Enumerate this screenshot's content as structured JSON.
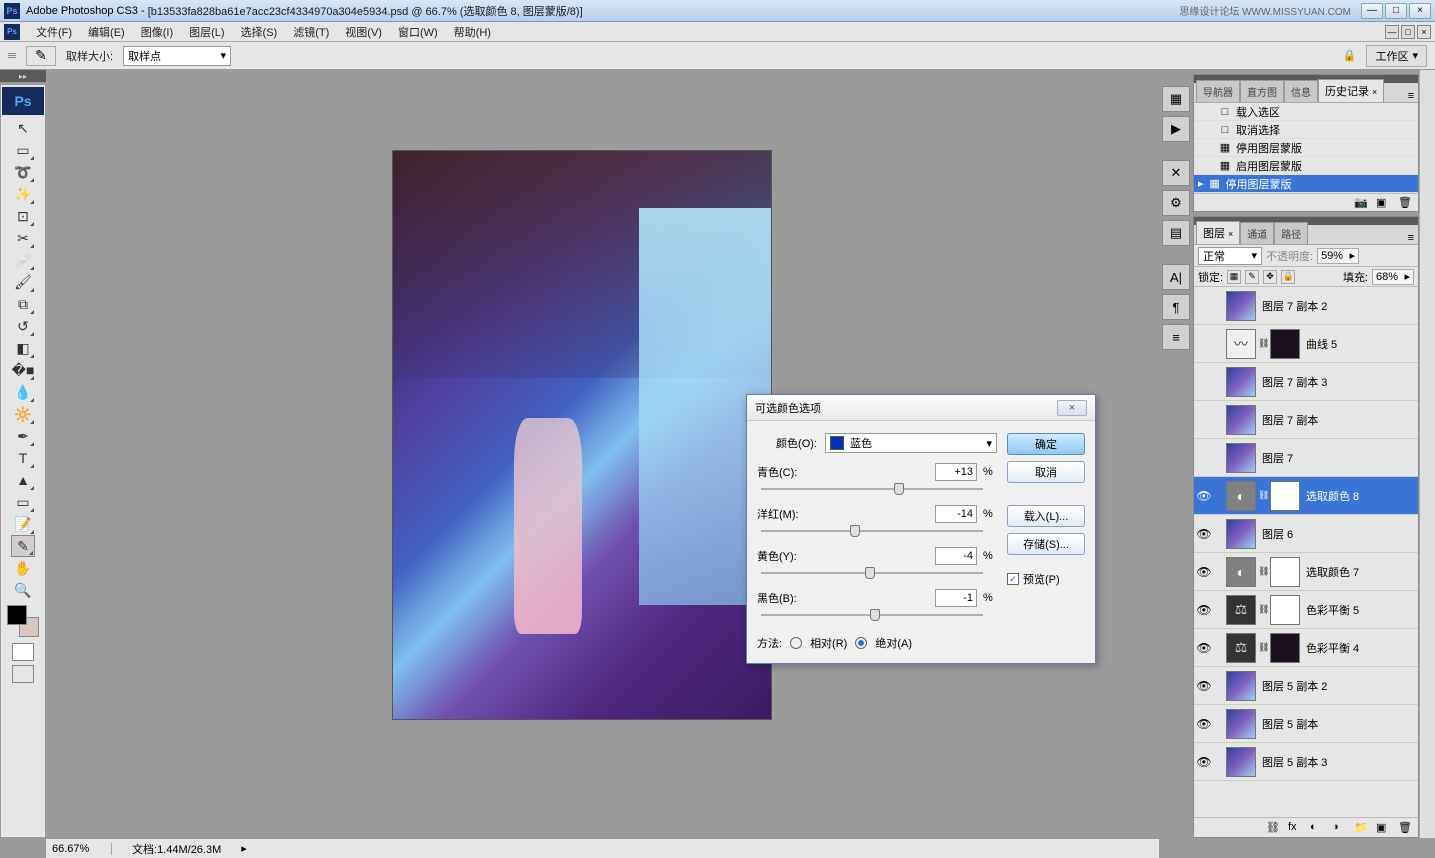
{
  "app": {
    "name": "Adobe Photoshop CS3",
    "doc_title": "[b13533fa828ba61e7acc23cf4334970a304e5934.psd @ 66.7% (选取颜色 8, 图层蒙版/8)]",
    "watermark": "思缘设计论坛 WWW.MISSYUAN.COM"
  },
  "menu": {
    "file": "文件(F)",
    "edit": "编辑(E)",
    "image": "图像(I)",
    "layer": "图层(L)",
    "select": "选择(S)",
    "filter": "滤镜(T)",
    "view": "视图(V)",
    "window": "窗口(W)",
    "help": "帮助(H)"
  },
  "options": {
    "sample_size_label": "取样大小:",
    "sample_size_value": "取样点",
    "workspace": "工作区"
  },
  "history_panel": {
    "tabs": {
      "nav": "导航器",
      "histogram": "直方图",
      "info": "信息",
      "history": "历史记录"
    },
    "items": [
      {
        "icon": "□",
        "label": "载入选区"
      },
      {
        "icon": "□",
        "label": "取消选择"
      },
      {
        "icon": "▦",
        "label": "停用图层蒙版"
      },
      {
        "icon": "▦",
        "label": "启用图层蒙版"
      },
      {
        "icon": "▦",
        "label": "停用图层蒙版"
      }
    ]
  },
  "layers_panel": {
    "tabs": {
      "layers": "图层",
      "channels": "通道",
      "paths": "路径"
    },
    "blend_mode": "正常",
    "opacity_label": "不透明度:",
    "opacity": "59%",
    "lock_label": "锁定:",
    "fill_label": "填充:",
    "fill": "68%",
    "layers": [
      {
        "visible": false,
        "thumb": "img",
        "name": "图层 7 副本 2"
      },
      {
        "visible": false,
        "thumb": "curves",
        "mask": "dark",
        "name": "曲线 5"
      },
      {
        "visible": false,
        "thumb": "img",
        "name": "图层 7 副本 3"
      },
      {
        "visible": false,
        "thumb": "img",
        "name": "图层 7 副本"
      },
      {
        "visible": false,
        "thumb": "img",
        "name": "图层 7"
      },
      {
        "visible": true,
        "thumb": "adjust",
        "mask": "white",
        "name": "选取颜色 8",
        "selected": true
      },
      {
        "visible": true,
        "thumb": "img",
        "name": "图层 6"
      },
      {
        "visible": true,
        "thumb": "adjust",
        "mask": "white",
        "name": "选取颜色 7"
      },
      {
        "visible": true,
        "thumb": "balance",
        "mask": "white",
        "name": "色彩平衡 5"
      },
      {
        "visible": true,
        "thumb": "balance",
        "mask": "dark",
        "name": "色彩平衡 4"
      },
      {
        "visible": true,
        "thumb": "img",
        "name": "图层 5 副本 2"
      },
      {
        "visible": true,
        "thumb": "img",
        "name": "图层 5 副本"
      },
      {
        "visible": true,
        "thumb": "img",
        "name": "图层 5 副本 3"
      }
    ]
  },
  "dialog": {
    "title": "可选颜色选项",
    "color_label": "颜色(O):",
    "color_value": "蓝色",
    "sliders": {
      "cyan": {
        "label": "青色(C):",
        "value": "+13",
        "pos": 60
      },
      "magenta": {
        "label": "洋红(M):",
        "value": "-14",
        "pos": 40
      },
      "yellow": {
        "label": "黄色(Y):",
        "value": "-4",
        "pos": 47
      },
      "black": {
        "label": "黑色(B):",
        "value": "-1",
        "pos": 49
      }
    },
    "method_label": "方法:",
    "relative": "相对(R)",
    "absolute": "绝对(A)",
    "buttons": {
      "ok": "确定",
      "cancel": "取消",
      "load": "载入(L)...",
      "save": "存储(S)..."
    },
    "preview": "预览(P)",
    "percent": "%"
  },
  "status": {
    "zoom": "66.67%",
    "doc_label": "文档:",
    "doc_size": "1.44M/26.3M"
  },
  "glyph": {
    "dropdown": "▾",
    "close": "×",
    "min": "—",
    "max": "□",
    "eye": "👁",
    "trash": "🗑",
    "new": "▣",
    "link": "⛓",
    "check": "✓",
    "arrow_r": "▸",
    "menu": "≡",
    "camera": "📷",
    "play": "▶"
  }
}
